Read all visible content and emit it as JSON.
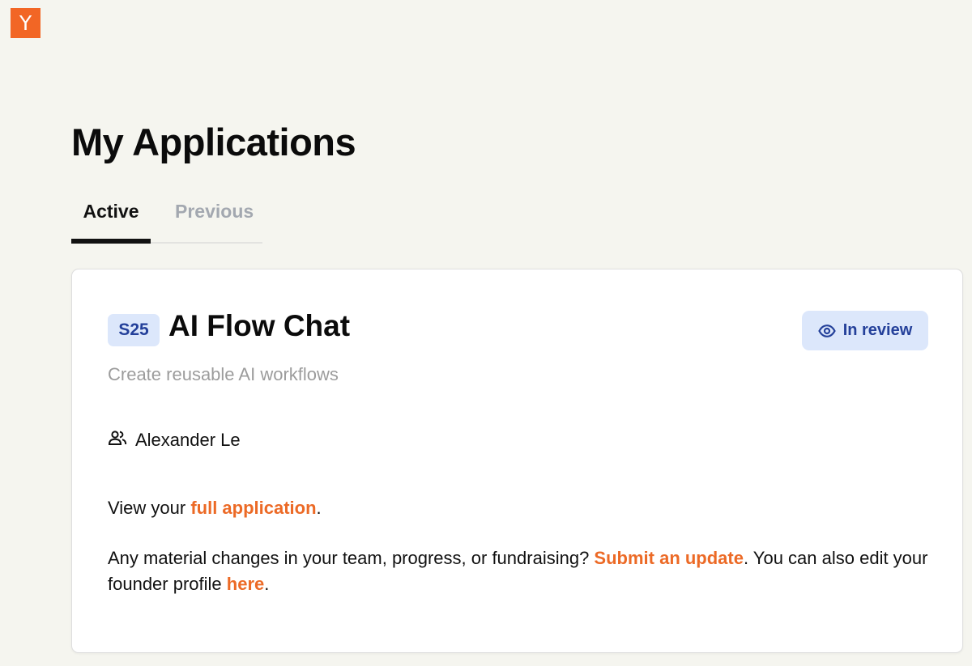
{
  "header": {
    "logo_letter": "Y",
    "brand_color": "#f26625"
  },
  "page": {
    "title": "My Applications"
  },
  "tabs": [
    {
      "label": "Active",
      "selected": true
    },
    {
      "label": "Previous",
      "selected": false
    }
  ],
  "application": {
    "batch": "S25",
    "company_name": "AI Flow Chat",
    "tagline": "Create reusable AI workflows",
    "status": {
      "label": "In review",
      "icon": "eye-icon"
    },
    "founders_icon": "people-icon",
    "founders": "Alexander Le",
    "view": {
      "prefix": "View your ",
      "link": "full application",
      "suffix": "."
    },
    "update": {
      "prefix": "Any material changes in your team, progress, or fundraising? ",
      "link": "Submit an update",
      "middle": ". You can also edit your founder profile ",
      "profile_link": "here",
      "suffix": "."
    }
  },
  "colors": {
    "background": "#f5f5ef",
    "link": "#ec6a26",
    "badge_bg": "#dce7fb",
    "badge_text": "#24409a",
    "muted_text": "#9c9c9c",
    "inactive_tab": "#a3a8b0"
  }
}
